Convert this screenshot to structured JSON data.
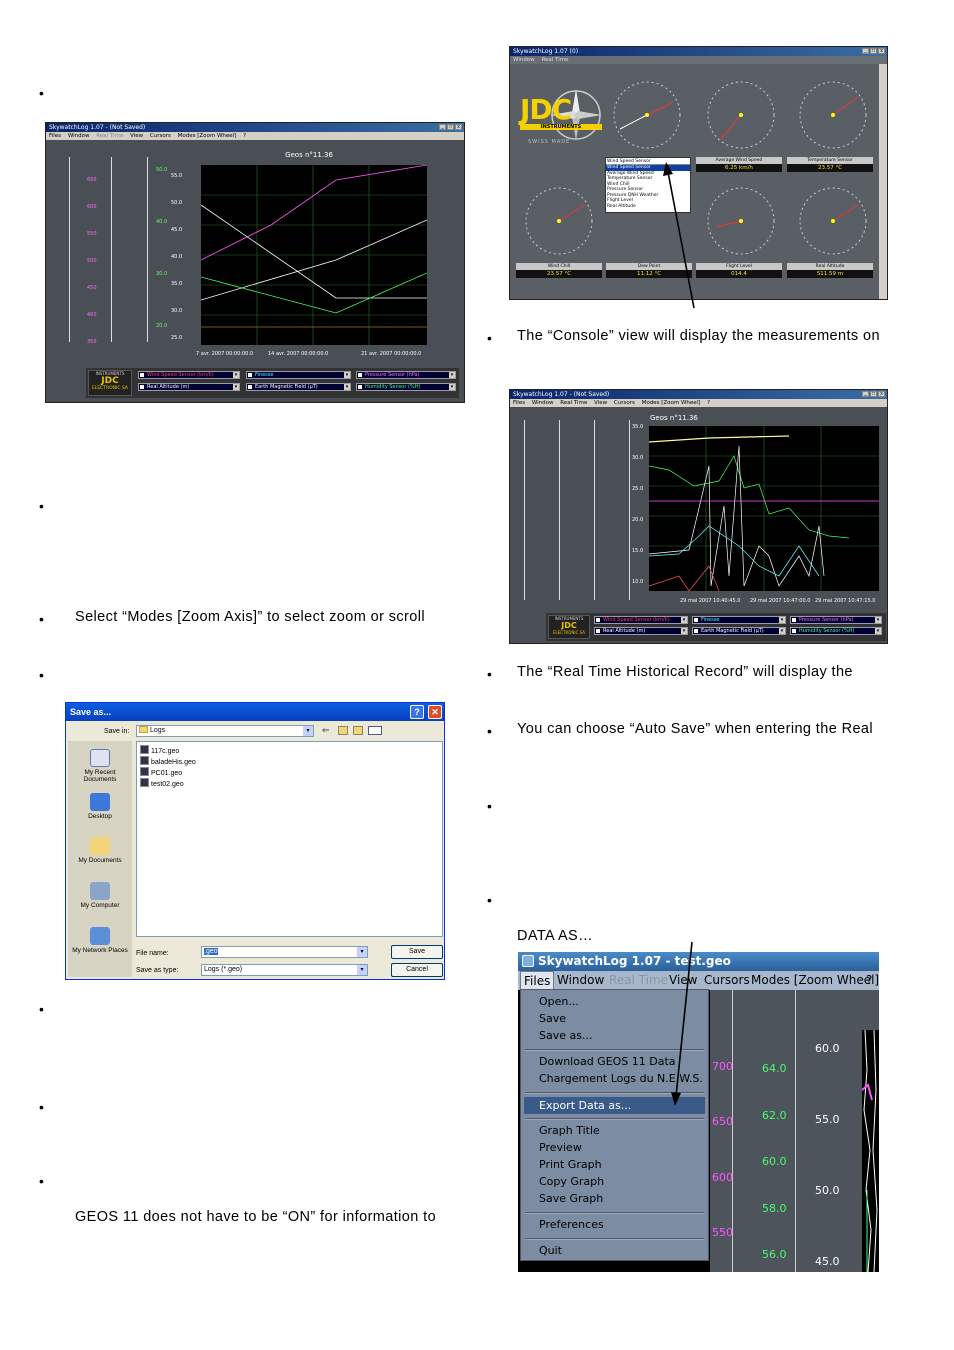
{
  "left_column": {
    "paragraphs": [
      "Select “Modes [Zoom Axis]” to select zoom or scroll",
      "GEOS 11 does not have to be “ON” for information to"
    ]
  },
  "right_column": {
    "paragraphs": [
      "The “Console” view will display the measurements on",
      "The “Real Time Historical Record” will display the",
      "You can choose “Auto Save” when entering the Real",
      "DATA AS…"
    ]
  },
  "screenshot1": {
    "title": "SkywatchLog 1.07 - (Not Saved)",
    "menu": [
      "Files",
      "Window",
      "Real Time",
      "View",
      "Cursors",
      "Modes [Zoom Wheel]",
      "?"
    ],
    "graph_title": "Geos n°11.36",
    "left_axis_ticks": [
      "650",
      "600",
      "550",
      "500",
      "450",
      "400",
      "350"
    ],
    "mid_axis_ticks": [
      "50.0",
      "40.0",
      "30.0",
      "20.0"
    ],
    "y_ticks": [
      "55.0",
      "50.0",
      "45.0",
      "40.0",
      "35.0",
      "30.0",
      "25.0"
    ],
    "x_ticks": [
      "7 avr. 2007 00:00:00.0",
      "14 avr. 2007 00:00:00.0",
      "21 avr. 2007 00:00:00.0"
    ],
    "brand_top": "INSTRUMENTS",
    "brand_bottom": "ELECTRONIC SA",
    "selectors": [
      "Wind Speed Sensor (km/h)",
      "Finesse",
      "Pressure Sensor (hPa)",
      "Real Altitude (m)",
      "Earth Magnetic Field (µT)",
      "Humidity Sensor (%H)"
    ],
    "colors": {
      "pink": "#ff44ff",
      "green": "#44ff66",
      "white": "#ffffff",
      "cyan": "#44ddff",
      "red": "#ff3333"
    }
  },
  "screenshot2": {
    "title": "SkywatchLog 1.07 (0)",
    "menu": [
      "Window",
      "Real Time"
    ],
    "logo": "JDC",
    "logo_sub": "INSTRUMENTS",
    "swiss": "SWISS MADE",
    "dropdown_selected": "Wind Speed Sensor",
    "dropdown_items": [
      "Wind Speed Sensor",
      "Average Wind Speed",
      "Temperature Sensor",
      "Wind Chill",
      "Pressure Sensor",
      "Pressure QNH Weather",
      "Flight Level",
      "Real Altitude"
    ],
    "gauges_top": [
      {
        "label": "Average Wind Speed",
        "value": "6.25 km/h"
      },
      {
        "label": "Temperature Sensor",
        "value": "23.57 °C"
      }
    ],
    "gauges_bottom": [
      {
        "label": "Wind Chill",
        "value": "23.57 °C"
      },
      {
        "label": "Dew Point",
        "value": "11.12 °C"
      },
      {
        "label": "Flight Level",
        "value": "014.4"
      },
      {
        "label": "Real Altitude",
        "value": "511.59 m"
      }
    ]
  },
  "screenshot3": {
    "title": "SkywatchLog 1.07 - (Not Saved)",
    "menu": [
      "Files",
      "Window",
      "Real Time",
      "View",
      "Cursors",
      "Modes [Zoom Wheel]",
      "?"
    ],
    "graph_title": "Geos n°11.36",
    "y_ticks": [
      "35.0",
      "30.0",
      "25.0",
      "20.0",
      "15.0",
      "10.0"
    ],
    "x_ticks": [
      "29 mai 2007 10:40:45.0",
      "29 mai 2007 10:47:00.0",
      "29 mai 2007 10:47:15.0"
    ],
    "brand_top": "INSTRUMENTS",
    "brand_bottom": "ELECTRONIC SA",
    "selectors": [
      "Wind Speed Sensor (km/h)",
      "Finesse",
      "Pressure Sensor (hPa)",
      "Real Altitude (m)",
      "Earth Magnetic Field (µT)",
      "Humidity Sensor (%H)"
    ]
  },
  "save_dialog": {
    "title": "Save as...",
    "save_in_label": "Save in:",
    "save_in_value": "Logs",
    "places": [
      "My Recent Documents",
      "Desktop",
      "My Documents",
      "My Computer",
      "My Network Places"
    ],
    "files": [
      "117c.geo",
      "baladeHis.geo",
      "PC01.geo",
      "test02.geo"
    ],
    "file_name_label": "File name:",
    "file_name_value": ".geo",
    "save_type_label": "Save as type:",
    "save_type_value": "Logs (*.geo)",
    "save_button": "Save",
    "cancel_button": "Cancel"
  },
  "files_menu": {
    "title": "SkywatchLog 1.07 - test.geo",
    "menubar": [
      "Files",
      "Window",
      "Real Time",
      "View",
      "Cursors",
      "Modes [Zoom Wheel]",
      "?"
    ],
    "items": [
      "Open...",
      "Save",
      "Save as...",
      "Download GEOS 11 Data",
      "Chargement Logs du N.E.W.S.",
      "Export Data as...",
      "Graph Title",
      "Preview",
      "Print Graph",
      "Copy Graph",
      "Save Graph",
      "Preferences",
      "Quit"
    ],
    "pink_ticks": [
      "700",
      "650",
      "600",
      "550"
    ],
    "green_ticks": [
      "64.0",
      "62.0",
      "60.0",
      "58.0",
      "56.0"
    ],
    "white_ticks": [
      "60.0",
      "55.0",
      "50.0",
      "45.0"
    ]
  }
}
